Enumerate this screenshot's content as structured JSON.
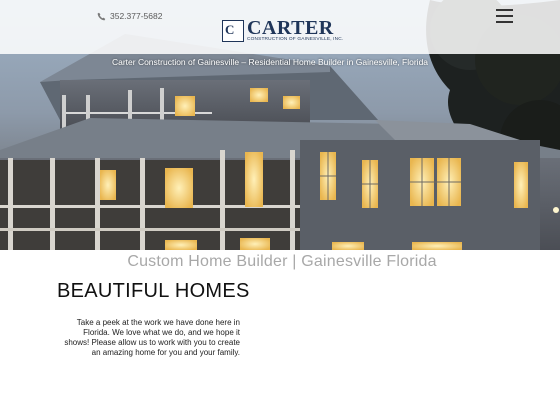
{
  "header": {
    "phone": "352.377-5682",
    "logo": {
      "mark": "C",
      "name": "CARTER",
      "sub": "CONSTRUCTION OF GAINESVILLE, INC."
    },
    "menu_icon": "hamburger-menu-icon",
    "phone_icon": "phone-icon"
  },
  "hero": {
    "tagline": "Carter Construction of Gainesville – Residential Home Builder in Gainesville, Florida"
  },
  "main": {
    "subtitle": "Custom Home Builder | Gainesville Florida",
    "heading": "BEAUTIFUL HOMES",
    "intro": "Take a peek at the work we have done here in Florida.  We love what we do, and we hope it shows!  Please allow us to work with you to create an amazing home for you and your family."
  },
  "colors": {
    "brand": "#1f3559",
    "subtitle_gray": "#a8a8a8"
  }
}
